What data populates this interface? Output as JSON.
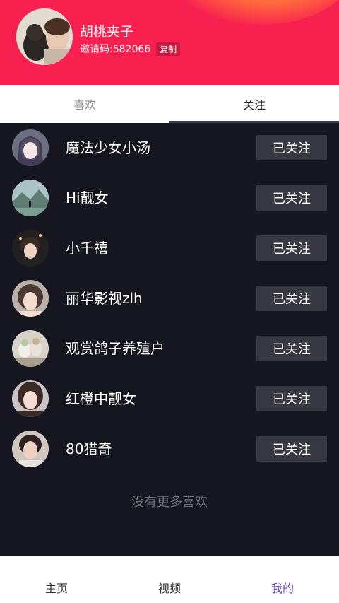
{
  "profile": {
    "name": "胡桃夹子",
    "invite_label": "邀请码:582066",
    "copy_label": "复制"
  },
  "tabs": [
    {
      "label": "喜欢",
      "active": false
    },
    {
      "label": "关注",
      "active": true
    }
  ],
  "follow_list": [
    {
      "name": "魔法少女小汤",
      "button": "已关注"
    },
    {
      "name": "Hi靓女",
      "button": "已关注"
    },
    {
      "name": "小千禧",
      "button": "已关注"
    },
    {
      "name": "丽华影视zlh",
      "button": "已关注"
    },
    {
      "name": "观赏鸽子养殖户",
      "button": "已关注"
    },
    {
      "name": "红橙中靓女",
      "button": "已关注"
    },
    {
      "name": "80猎奇",
      "button": "已关注"
    }
  ],
  "footer_text": "没有更多喜欢",
  "nav": [
    {
      "label": "主页",
      "active": false
    },
    {
      "label": "视频",
      "active": false
    },
    {
      "label": "我的",
      "active": true
    }
  ],
  "colors": {
    "header_bg": "#f7204f",
    "list_bg": "#15161f",
    "button_bg": "#373842",
    "nav_active": "#5b3fb3"
  }
}
